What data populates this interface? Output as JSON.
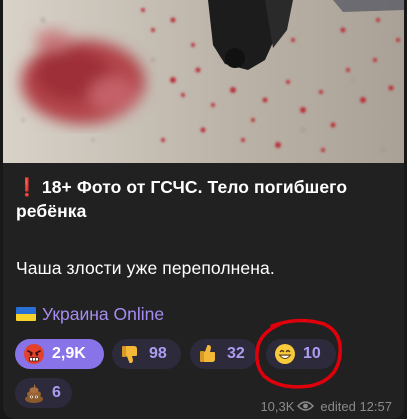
{
  "post": {
    "title_mark": "❗",
    "title": "18+ Фото от ГСЧС. Тело погибшего ребёнка",
    "body": "Чаша злости уже переполнена.",
    "channel_name": "Украина Online"
  },
  "reactions": [
    {
      "emoji": "angry-face",
      "count": "2,9K",
      "chosen": true
    },
    {
      "emoji": "thumbs-down",
      "count": "98",
      "chosen": false
    },
    {
      "emoji": "thumbs-up",
      "count": "32",
      "chosen": false
    },
    {
      "emoji": "grinning-face",
      "count": "10",
      "chosen": false
    },
    {
      "emoji": "pile-of-poo",
      "count": "6",
      "chosen": false
    }
  ],
  "meta": {
    "views": "10,3K",
    "edited": "edited 12:57"
  },
  "colors": {
    "accent": "#8873e8",
    "highlight_circle": "#e0000b",
    "channel_link": "#a58cf2"
  }
}
